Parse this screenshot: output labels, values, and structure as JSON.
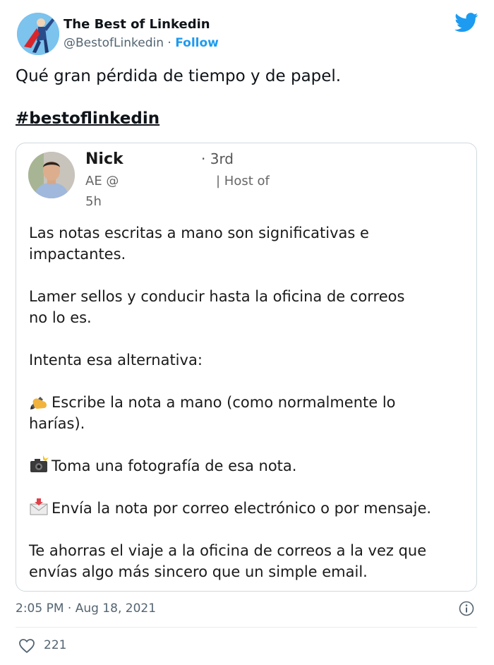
{
  "author": {
    "name": "The Best of Linkedin",
    "handle": "@BestofLinkedin",
    "separator": "·",
    "follow": "Follow"
  },
  "tweet": {
    "text": "Qué gran pérdida de tiempo y de papel.",
    "hashtag": "#bestoflinkedin"
  },
  "post": {
    "name": "Nick",
    "degree": "· 3rd",
    "role": "AE @",
    "host": "| Host of",
    "time": "5h",
    "p1_line1": "Las notas escritas a mano son significativas e",
    "p1_line2": "impactantes.",
    "p2_line1": "Lamer sellos y conducir hasta la oficina de correos",
    "p2_line2": "no lo es.",
    "p3": "Intenta esa alternativa:",
    "p4_line1": "Escribe la nota a mano (como normalmente lo",
    "p4_line2": "harías).",
    "p5": "Toma una fotografía de esa nota.",
    "p6": "Envía la nota por correo electrónico o por mensaje.",
    "p7_line1": "Te ahorras el viaje a la oficina de correos a la vez que",
    "p7_line2": "envías algo más sincero que un simple email."
  },
  "footer": {
    "timestamp": "2:05 PM · Aug 18, 2021",
    "likes": "221"
  },
  "icons": {
    "bird": "twitter-bird-icon",
    "info": "info-icon",
    "heart": "heart-icon",
    "writing": "writing-hand-icon",
    "camera": "camera-flash-icon",
    "mail": "incoming-envelope-icon"
  },
  "colors": {
    "accent": "#1d9bf0",
    "text": "#0f1419",
    "secondary": "#536471",
    "border": "#cfd9de"
  }
}
